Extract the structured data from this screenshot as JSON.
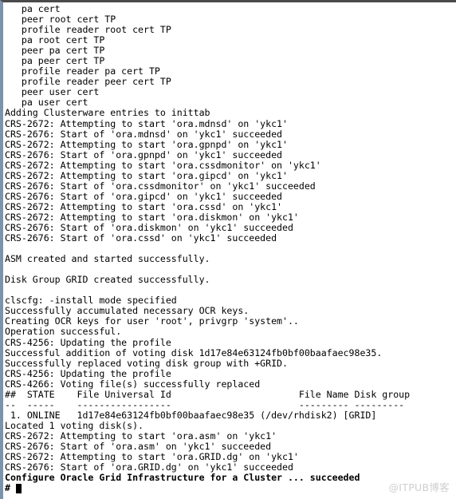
{
  "window": {
    "border_top_color": "#4a4a4a",
    "border_left_color": "#7b94ab",
    "background_color": "#ffffff",
    "text_color": "#000000"
  },
  "terminal": {
    "lines": [
      {
        "text": "   pa cert",
        "bold": false
      },
      {
        "text": "   peer root cert TP",
        "bold": false
      },
      {
        "text": "   profile reader root cert TP",
        "bold": false
      },
      {
        "text": "   pa root cert TP",
        "bold": false
      },
      {
        "text": "   peer pa cert TP",
        "bold": false
      },
      {
        "text": "   pa peer cert TP",
        "bold": false
      },
      {
        "text": "   profile reader pa cert TP",
        "bold": false
      },
      {
        "text": "   profile reader peer cert TP",
        "bold": false
      },
      {
        "text": "   peer user cert",
        "bold": false
      },
      {
        "text": "   pa user cert",
        "bold": false
      },
      {
        "text": "Adding Clusterware entries to inittab",
        "bold": false
      },
      {
        "text": "CRS-2672: Attempting to start 'ora.mdnsd' on 'ykc1'",
        "bold": false
      },
      {
        "text": "CRS-2676: Start of 'ora.mdnsd' on 'ykc1' succeeded",
        "bold": false
      },
      {
        "text": "CRS-2672: Attempting to start 'ora.gpnpd' on 'ykc1'",
        "bold": false
      },
      {
        "text": "CRS-2676: Start of 'ora.gpnpd' on 'ykc1' succeeded",
        "bold": false
      },
      {
        "text": "CRS-2672: Attempting to start 'ora.cssdmonitor' on 'ykc1'",
        "bold": false
      },
      {
        "text": "CRS-2672: Attempting to start 'ora.gipcd' on 'ykc1'",
        "bold": false
      },
      {
        "text": "CRS-2676: Start of 'ora.cssdmonitor' on 'ykc1' succeeded",
        "bold": false
      },
      {
        "text": "CRS-2676: Start of 'ora.gipcd' on 'ykc1' succeeded",
        "bold": false
      },
      {
        "text": "CRS-2672: Attempting to start 'ora.cssd' on 'ykc1'",
        "bold": false
      },
      {
        "text": "CRS-2672: Attempting to start 'ora.diskmon' on 'ykc1'",
        "bold": false
      },
      {
        "text": "CRS-2676: Start of 'ora.diskmon' on 'ykc1' succeeded",
        "bold": false
      },
      {
        "text": "CRS-2676: Start of 'ora.cssd' on 'ykc1' succeeded",
        "bold": false
      },
      {
        "text": "",
        "bold": false
      },
      {
        "text": "ASM created and started successfully.",
        "bold": false
      },
      {
        "text": "",
        "bold": false
      },
      {
        "text": "Disk Group GRID created successfully.",
        "bold": false
      },
      {
        "text": "",
        "bold": false
      },
      {
        "text": "clscfg: -install mode specified",
        "bold": false
      },
      {
        "text": "Successfully accumulated necessary OCR keys.",
        "bold": false
      },
      {
        "text": "Creating OCR keys for user 'root', privgrp 'system'..",
        "bold": false
      },
      {
        "text": "Operation successful.",
        "bold": false
      },
      {
        "text": "CRS-4256: Updating the profile",
        "bold": false
      },
      {
        "text": "Successful addition of voting disk 1d17e84e63124fb0bf00baafaec98e35.",
        "bold": false
      },
      {
        "text": "Successfully replaced voting disk group with +GRID.",
        "bold": false
      },
      {
        "text": "CRS-4256: Updating the profile",
        "bold": false
      },
      {
        "text": "CRS-4266: Voting file(s) successfully replaced",
        "bold": false
      },
      {
        "text": "##  STATE    File Universal Id                       File Name Disk group",
        "bold": false
      },
      {
        "text": "--  -----    -----------------                       --------- ---------",
        "bold": false
      },
      {
        "text": " 1. ONLINE   1d17e84e63124fb0bf00baafaec98e35 (/dev/rhdisk2) [GRID]",
        "bold": false
      },
      {
        "text": "Located 1 voting disk(s).",
        "bold": false
      },
      {
        "text": "CRS-2672: Attempting to start 'ora.asm' on 'ykc1'",
        "bold": false
      },
      {
        "text": "CRS-2676: Start of 'ora.asm' on 'ykc1' succeeded",
        "bold": false
      },
      {
        "text": "CRS-2672: Attempting to start 'ora.GRID.dg' on 'ykc1'",
        "bold": false
      },
      {
        "text": "CRS-2676: Start of 'ora.GRID.dg' on 'ykc1' succeeded",
        "bold": false
      },
      {
        "text": "Configure Oracle Grid Infrastructure for a Cluster ... succeeded",
        "bold": true
      }
    ],
    "prompt": {
      "symbol": "# ",
      "cursor": "block"
    }
  },
  "watermark": {
    "text": "@ITPUB博客",
    "color": "#cfcfcf"
  }
}
